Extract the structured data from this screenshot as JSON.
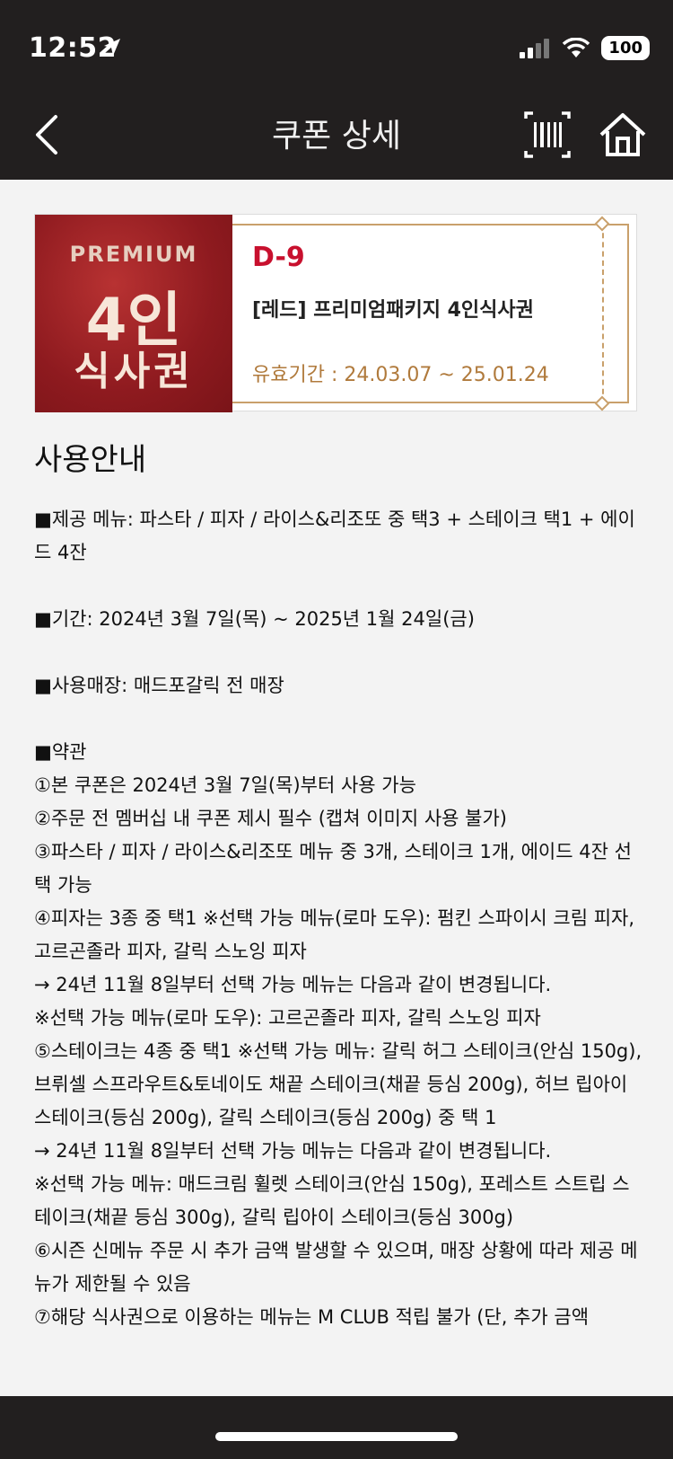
{
  "status_bar": {
    "time": "12:52",
    "battery": "100"
  },
  "header": {
    "title": "쿠폰 상세"
  },
  "coupon": {
    "badge_small": "PREMIUM",
    "badge_big1": "4인",
    "badge_big2": "식사권",
    "dday": "D-9",
    "name": "[레드] 프리미엄패키지 4인식사권",
    "validity": "유효기간 : 24.03.07 ~ 25.01.24"
  },
  "guide": {
    "title": "사용안내",
    "lines": [
      "■제공 메뉴: 파스타 / 피자 / 라이스&리조또 중 택3 + 스테이크 택1 + 에이드 4잔",
      "",
      "■기간: 2024년 3월 7일(목) ~ 2025년 1월 24일(금)",
      "",
      "■사용매장: 매드포갈릭 전 매장",
      "",
      "■약관",
      "①본 쿠폰은 2024년 3월 7일(목)부터 사용 가능",
      "②주문 전 멤버십 내 쿠폰 제시 필수 (캡쳐 이미지 사용 불가)",
      "③파스타 / 피자 / 라이스&리조또 메뉴 중 3개, 스테이크 1개, 에이드 4잔 선택 가능",
      "④피자는 3종 중 택1 ※선택 가능 메뉴(로마 도우): 펌킨 스파이시 크림 피자, 고르곤졸라 피자, 갈릭 스노잉 피자",
      "→ 24년 11월 8일부터 선택 가능 메뉴는 다음과 같이 변경됩니다.",
      "※선택 가능 메뉴(로마 도우): 고르곤졸라 피자, 갈릭 스노잉 피자",
      "⑤스테이크는 4종 중 택1 ※선택 가능 메뉴: 갈릭 허그 스테이크(안심 150g), 브뤼셀 스프라우트&토네이도 채끝 스테이크(채끝 등심 200g), 허브 립아이 스테이크(등심 200g), 갈릭 스테이크(등심 200g) 중 택 1",
      "→ 24년 11월 8일부터 선택 가능 메뉴는 다음과 같이 변경됩니다.",
      "※선택 가능 메뉴: 매드크림 휠렛 스테이크(안심 150g), 포레스트 스트립 스테이크(채끝 등심 300g), 갈릭 립아이 스테이크(등심 300g)",
      "⑥시즌 신메뉴 주문 시 추가 금액 발생할 수 있으며, 매장 상황에 따라 제공 메뉴가 제한될 수 있음",
      "⑦해당 식사권으로 이용하는 메뉴는 M CLUB 적립 불가 (단, 추가 금액"
    ]
  },
  "colors": {
    "bar": "#221f1f",
    "accent_red": "#c8102e",
    "gold": "#c9a06b",
    "validity": "#b07a3c"
  }
}
